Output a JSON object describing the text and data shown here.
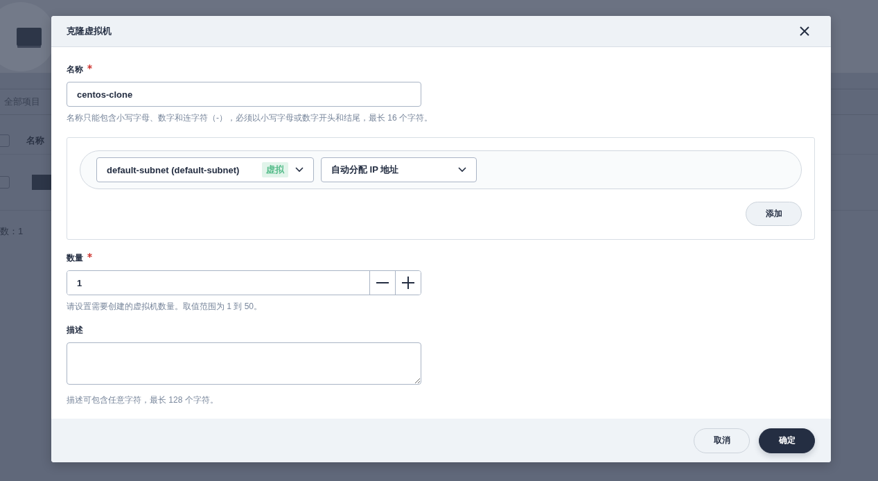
{
  "background": {
    "filter": "全部项目",
    "header_checkbox": {
      "checked": false
    },
    "column": "名称",
    "rows": [
      {
        "checked": false
      }
    ],
    "total": "数：1"
  },
  "dialog": {
    "title": "克隆虚拟机",
    "name_field": {
      "label": "名称",
      "required": true,
      "value": "centos-clone",
      "hint": "名称只能包含小写字母、数字和连字符（-），必须以小写字母或数字开头和结尾，最长 16 个字符。"
    },
    "network": {
      "subnet": {
        "value": "default-subnet (default-subnet)",
        "tag": "虚拟"
      },
      "ip": {
        "value": "自动分配 IP 地址"
      },
      "add_button": "添加"
    },
    "count_field": {
      "label": "数量",
      "required": true,
      "value": "1",
      "hint": "请设置需要创建的虚拟机数量。取值范围为 1 到 50。"
    },
    "description_field": {
      "label": "描述",
      "required": false,
      "hint": "描述可包含任意字符，最长 128 个字符。"
    },
    "buttons": [
      {
        "label": "取消",
        "kind": "secondary"
      },
      {
        "label": "确定",
        "kind": "primary"
      }
    ]
  }
}
